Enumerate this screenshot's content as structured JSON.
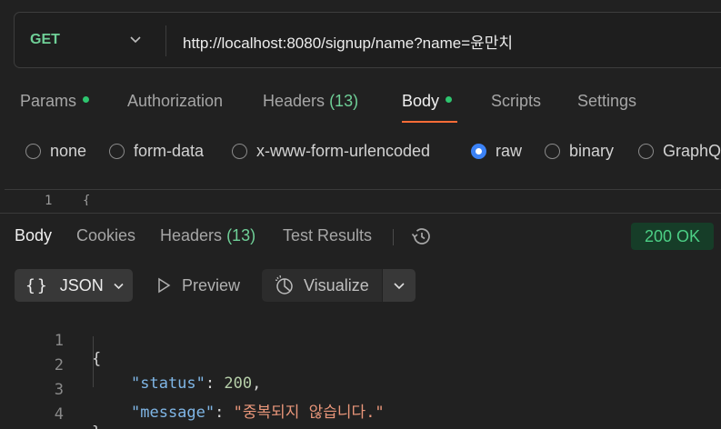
{
  "request": {
    "method": "GET",
    "url": "http://localhost:8080/signup/name?name=윤만치"
  },
  "request_tabs": {
    "params": "Params",
    "authorization": "Authorization",
    "headers": "Headers",
    "headers_count": "(13)",
    "body": "Body",
    "scripts": "Scripts",
    "settings": "Settings"
  },
  "body_types": {
    "none": "none",
    "form_data": "form-data",
    "urlencoded": "x-www-form-urlencoded",
    "raw": "raw",
    "binary": "binary",
    "graphql": "GraphQ",
    "selected": "raw"
  },
  "editor": {
    "line_number": "1",
    "first_char": "{"
  },
  "response_tabs": {
    "body": "Body",
    "cookies": "Cookies",
    "headers": "Headers",
    "headers_count": "(13)",
    "test_results": "Test Results"
  },
  "status": "200 OK",
  "toolbar": {
    "format": "JSON",
    "preview": "Preview",
    "visualize": "Visualize"
  },
  "response_body": {
    "line_numbers": [
      "1",
      "2",
      "3",
      "4"
    ],
    "open_brace": "{",
    "status_key": "\"status\"",
    "status_value": "200",
    "message_key": "\"message\"",
    "message_value": "\"중복되지 않습니다.\"",
    "close_brace": "}"
  },
  "colors": {
    "accent": "#ff6c37",
    "method_get": "#6fcf97",
    "status_ok": "#4ccf85",
    "radio_selected": "#3b82f6"
  }
}
